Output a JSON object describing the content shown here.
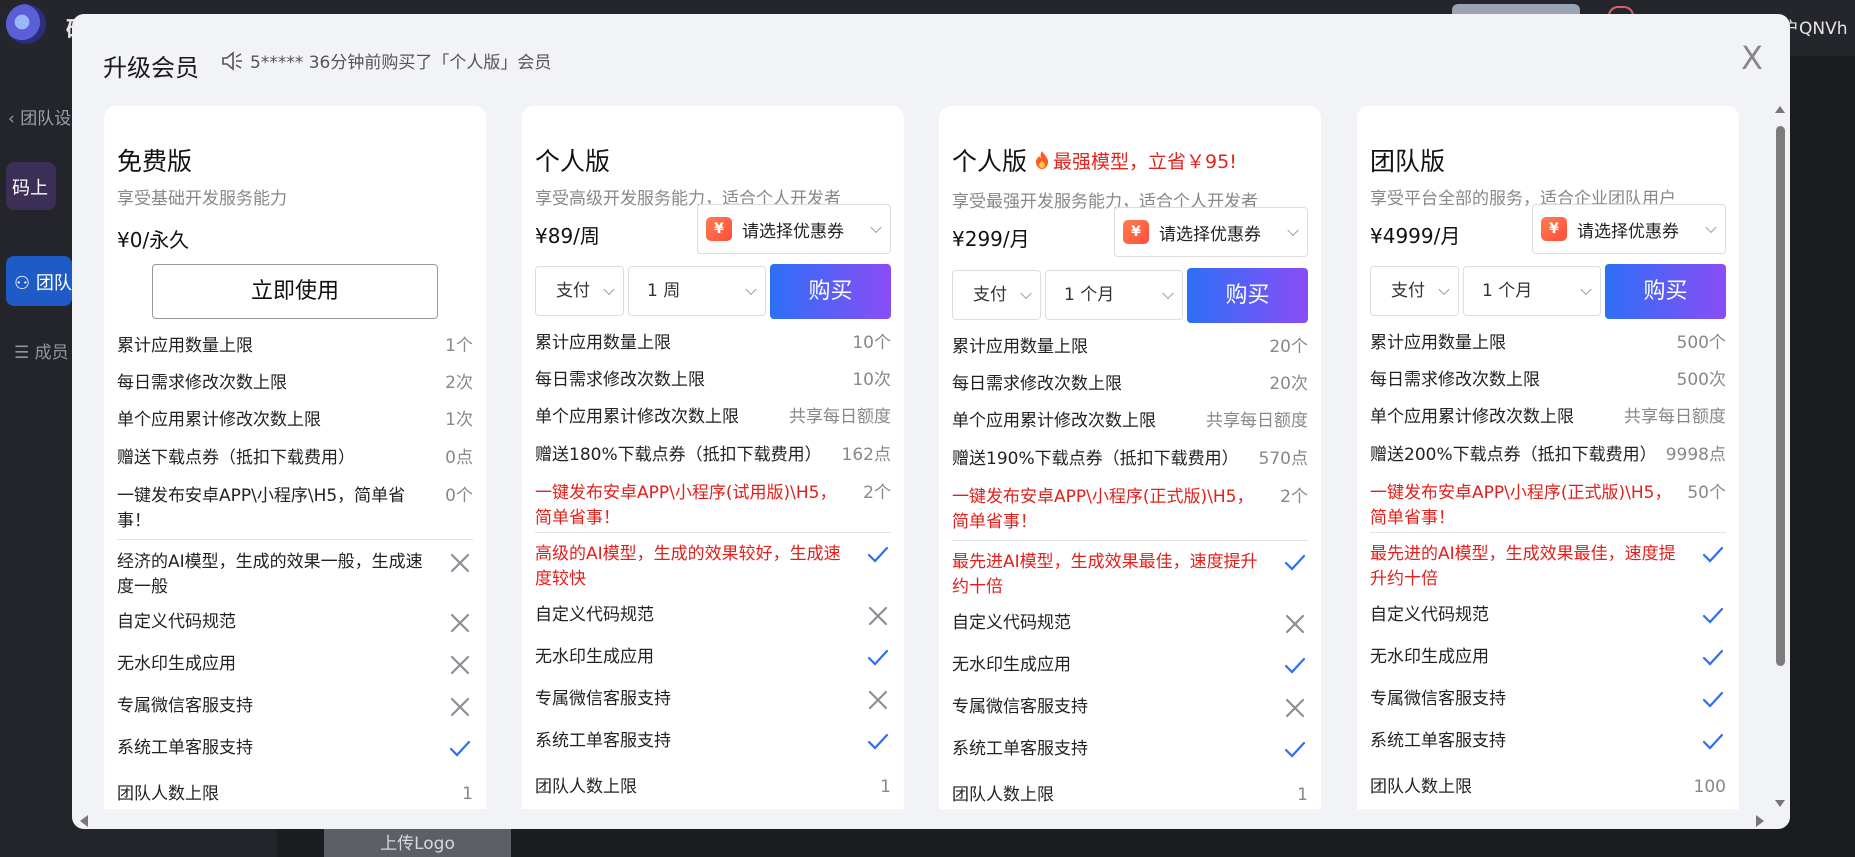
{
  "background": {
    "logo_text": "码",
    "user_text": "户QNVh",
    "back_link": "团队设",
    "tile_text": "码上",
    "team_label": "团队",
    "member_label": "成员",
    "upload_label": "上传Logo"
  },
  "modal": {
    "title": "升级会员",
    "notice": "5***** 36分钟前购买了「个人版」会员",
    "close_label": "X"
  },
  "icons": {
    "check_color": "#2f6ff0",
    "cross_color": "#8a8f99",
    "accent_gradient": [
      "#2d6ff6",
      "#8a4df5"
    ],
    "red_text": "#e3201c"
  },
  "plans": [
    {
      "name": "免费版",
      "promo": "",
      "desc": "享受基础开发服务能力",
      "price": "¥0/永久",
      "action": "立即使用",
      "limits": [
        {
          "label": "累计应用数量上限",
          "value": "1个"
        },
        {
          "label": "每日需求修改次数上限",
          "value": "2次"
        },
        {
          "label": "单个应用累计修改次数上限",
          "value": "1次"
        },
        {
          "label": "赠送下载点券（抵扣下载费用）",
          "value": "0点"
        },
        {
          "label": "一键发布安卓APP\\小程序\\H5，简单省事！",
          "value": "0个"
        }
      ],
      "features": [
        {
          "label": "经济的AI模型，生成的效果一般，生成速度一般",
          "included": false
        },
        {
          "label": "自定义代码规范",
          "included": false
        },
        {
          "label": "无水印生成应用",
          "included": false
        },
        {
          "label": "专属微信客服支持",
          "included": false
        },
        {
          "label": "系统工单客服支持",
          "included": true
        }
      ],
      "team_limit": {
        "label": "团队人数上限",
        "value": "1"
      }
    },
    {
      "name": "个人版",
      "promo": "",
      "desc": "享受高级开发服务能力，适合个人开发者",
      "price": "¥89/周",
      "coupon": "请选择优惠券",
      "pay": "支付",
      "duration": "1 周",
      "buy": "购买",
      "limits": [
        {
          "label": "累计应用数量上限",
          "value": "10个"
        },
        {
          "label": "每日需求修改次数上限",
          "value": "10次"
        },
        {
          "label": "单个应用累计修改次数上限",
          "value": "共享每日额度"
        },
        {
          "label": "赠送180%下载点券（抵扣下载费用）",
          "value": "162点"
        },
        {
          "label": "一键发布安卓APP\\小程序(试用版)\\H5，简单省事！",
          "value": "2个",
          "red": true
        }
      ],
      "features": [
        {
          "label": "高级的AI模型，生成的效果较好，生成速度较快",
          "included": true,
          "red": true
        },
        {
          "label": "自定义代码规范",
          "included": false
        },
        {
          "label": "无水印生成应用",
          "included": true
        },
        {
          "label": "专属微信客服支持",
          "included": false
        },
        {
          "label": "系统工单客服支持",
          "included": true
        }
      ],
      "team_limit": {
        "label": "团队人数上限",
        "value": "1"
      }
    },
    {
      "name": "个人版",
      "promo": "最强模型，立省￥95!",
      "desc": "享受最强开发服务能力，适合个人开发者",
      "price": "¥299/月",
      "coupon": "请选择优惠券",
      "pay": "支付",
      "duration": "1 个月",
      "buy": "购买",
      "limits": [
        {
          "label": "累计应用数量上限",
          "value": "20个"
        },
        {
          "label": "每日需求修改次数上限",
          "value": "20次"
        },
        {
          "label": "单个应用累计修改次数上限",
          "value": "共享每日额度"
        },
        {
          "label": "赠送190%下载点券（抵扣下载费用）",
          "value": "570点"
        },
        {
          "label": "一键发布安卓APP\\小程序(正式版)\\H5，简单省事！",
          "value": "2个",
          "red": true
        }
      ],
      "features": [
        {
          "label": "最先进AI模型，生成效果最佳，速度提升约十倍",
          "included": true,
          "red": true
        },
        {
          "label": "自定义代码规范",
          "included": false
        },
        {
          "label": "无水印生成应用",
          "included": true
        },
        {
          "label": "专属微信客服支持",
          "included": false
        },
        {
          "label": "系统工单客服支持",
          "included": true
        }
      ],
      "team_limit": {
        "label": "团队人数上限",
        "value": "1"
      }
    },
    {
      "name": "团队版",
      "promo": "",
      "desc": "享受平台全部的服务，适合企业团队用户",
      "price": "¥4999/月",
      "coupon": "请选择优惠券",
      "pay": "支付",
      "duration": "1 个月",
      "buy": "购买",
      "limits": [
        {
          "label": "累计应用数量上限",
          "value": "500个"
        },
        {
          "label": "每日需求修改次数上限",
          "value": "500次"
        },
        {
          "label": "单个应用累计修改次数上限",
          "value": "共享每日额度"
        },
        {
          "label": "赠送200%下载点券（抵扣下载费用）",
          "value": "9998点"
        },
        {
          "label": "一键发布安卓APP\\小程序(正式版)\\H5，简单省事！",
          "value": "50个",
          "red": true
        }
      ],
      "features": [
        {
          "label": "最先进的AI模型，生成效果最佳，速度提升约十倍",
          "included": true,
          "red": true
        },
        {
          "label": "自定义代码规范",
          "included": true
        },
        {
          "label": "无水印生成应用",
          "included": true
        },
        {
          "label": "专属微信客服支持",
          "included": true
        },
        {
          "label": "系统工单客服支持",
          "included": true
        }
      ],
      "team_limit": {
        "label": "团队人数上限",
        "value": "100"
      }
    }
  ]
}
